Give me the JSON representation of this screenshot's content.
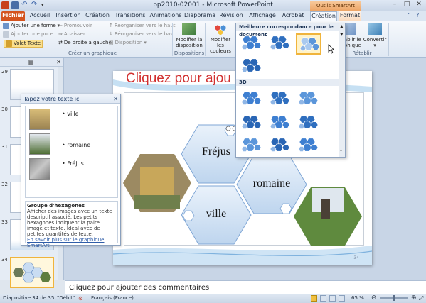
{
  "window": {
    "title": "pp2010-02001 - Microsoft PowerPoint",
    "context_band": "Outils SmartArt",
    "controls": [
      "–",
      "□",
      "✕"
    ]
  },
  "tabs": [
    {
      "label": "Fichier",
      "kind": "file"
    },
    {
      "label": "Accueil"
    },
    {
      "label": "Insertion"
    },
    {
      "label": "Création"
    },
    {
      "label": "Transitions"
    },
    {
      "label": "Animations"
    },
    {
      "label": "Diaporama"
    },
    {
      "label": "Révision"
    },
    {
      "label": "Affichage"
    },
    {
      "label": "Acrobat"
    },
    {
      "label": "Création",
      "kind": "ctx-active"
    },
    {
      "label": "Format",
      "kind": "ctx"
    }
  ],
  "ribbon": {
    "create_graphic": {
      "add_shape": "Ajouter une forme",
      "add_bullet": "Ajouter une puce",
      "text_pane": "Volet Texte",
      "promote": "Promouvoir",
      "demote": "Abaisser",
      "right_to_left": "De droite à gauche",
      "move_up": "Réorganiser vers le haut",
      "move_down": "Réorganiser vers le bas",
      "layout": "Disposition",
      "group_label": "Créer un graphique"
    },
    "layouts": {
      "change_layout": "Modifier la disposition",
      "group_label": "Dispositions"
    },
    "styles": {
      "change_colors": "Modifier les couleurs"
    },
    "reset": {
      "reset_graphic": "Rétablir le graphique",
      "convert": "Convertir",
      "group_label": "Rétablir"
    }
  },
  "slides_panel": {
    "slide_numbers": [
      "29",
      "30",
      "31",
      "32",
      "33",
      "34"
    ],
    "selected": "34"
  },
  "text_pane": {
    "title": "Tapez votre texte ici",
    "items": [
      "ville",
      "romaine",
      "Fréjus"
    ],
    "desc_title": "Groupe d'hexagones",
    "desc_body": "Afficher des images avec un texte descriptif associé. Les petits hexagones indiquent la paire image et texte. Idéal avec de petites quantités de texte.",
    "link": "En savoir plus sur le graphique SmartArt"
  },
  "slide": {
    "title": "Cliquez pour ajou",
    "number": "34",
    "hex_labels": [
      "Fréjus",
      "romaine",
      "ville"
    ]
  },
  "gallery": {
    "heading": "Meilleure correspondance pour le document",
    "section_3d": "3D"
  },
  "notes": {
    "placeholder": "Cliquez pour ajouter des commentaires"
  },
  "status": {
    "slide_info": "Diapositive 34 de 35",
    "theme": "\"Débit\"",
    "language": "Français (France)",
    "zoom": "65 %"
  },
  "colors": {
    "accent_blue": "#3e7fd1",
    "title_red": "#d1302f",
    "file_tab": "#d4531e",
    "context_orange": "#eda566"
  }
}
